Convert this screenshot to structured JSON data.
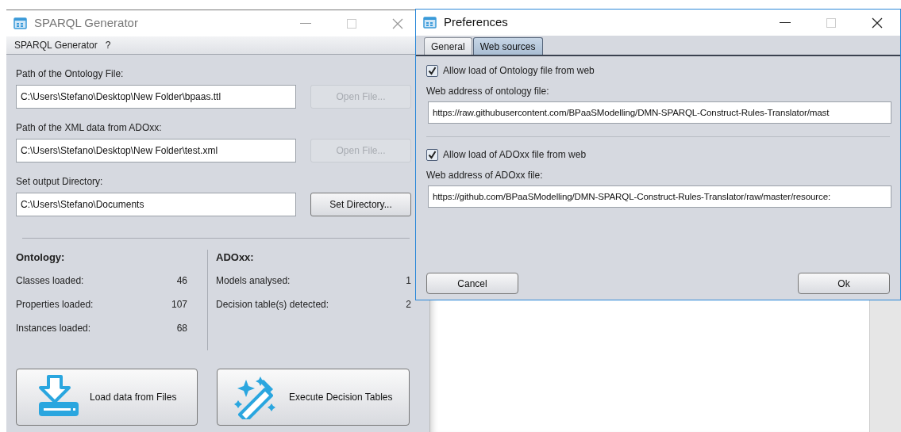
{
  "main_window": {
    "title": "SPARQL Generator",
    "menu": [
      "SPARQL Generator",
      "?"
    ],
    "fields": [
      {
        "label": "Path of the Ontology File:",
        "value": "C:\\Users\\Stefano\\Desktop\\New Folder\\bpaas.ttl",
        "button": "Open File...",
        "disabled": true
      },
      {
        "label": "Path of the XML data from ADOxx:",
        "value": "C:\\Users\\Stefano\\Desktop\\New Folder\\test.xml",
        "button": "Open File...",
        "disabled": true
      },
      {
        "label": "Set output Directory:",
        "value": "C:\\Users\\Stefano\\Documents",
        "button": "Set Directory...",
        "disabled": false
      }
    ],
    "stats": [
      {
        "heading": "Ontology:",
        "rows": [
          {
            "label": "Classes loaded:",
            "value": "46"
          },
          {
            "label": "Properties loaded:",
            "value": "107"
          },
          {
            "label": "Instances loaded:",
            "value": "68"
          }
        ]
      },
      {
        "heading": "ADOxx:",
        "rows": [
          {
            "label": "Models analysed:",
            "value": "1"
          },
          {
            "label": "Decision table(s) detected:",
            "value": "2"
          }
        ]
      }
    ],
    "actions": [
      {
        "label": "Load data from Files",
        "kind": "load"
      },
      {
        "label": "Execute Decision Tables",
        "kind": "execute"
      }
    ]
  },
  "preferences": {
    "title": "Preferences",
    "tabs": [
      {
        "label": "General",
        "selected": false
      },
      {
        "label": "Web sources",
        "selected": true
      }
    ],
    "sources": [
      {
        "checkbox": "Allow load of Ontology file from web",
        "checked": true,
        "address_label": "Web address of ontology file:",
        "address": "https://raw.githubusercontent.com/BPaaSModelling/DMN-SPARQL-Construct-Rules-Translator/mast"
      },
      {
        "checkbox": "Allow load of ADOxx file from web",
        "checked": true,
        "address_label": "Web address of ADOxx file:",
        "address": "https://github.com/BPaaSModelling/DMN-SPARQL-Construct-Rules-Translator/raw/master/resource:"
      }
    ],
    "buttons": [
      "Cancel",
      "Ok"
    ]
  }
}
